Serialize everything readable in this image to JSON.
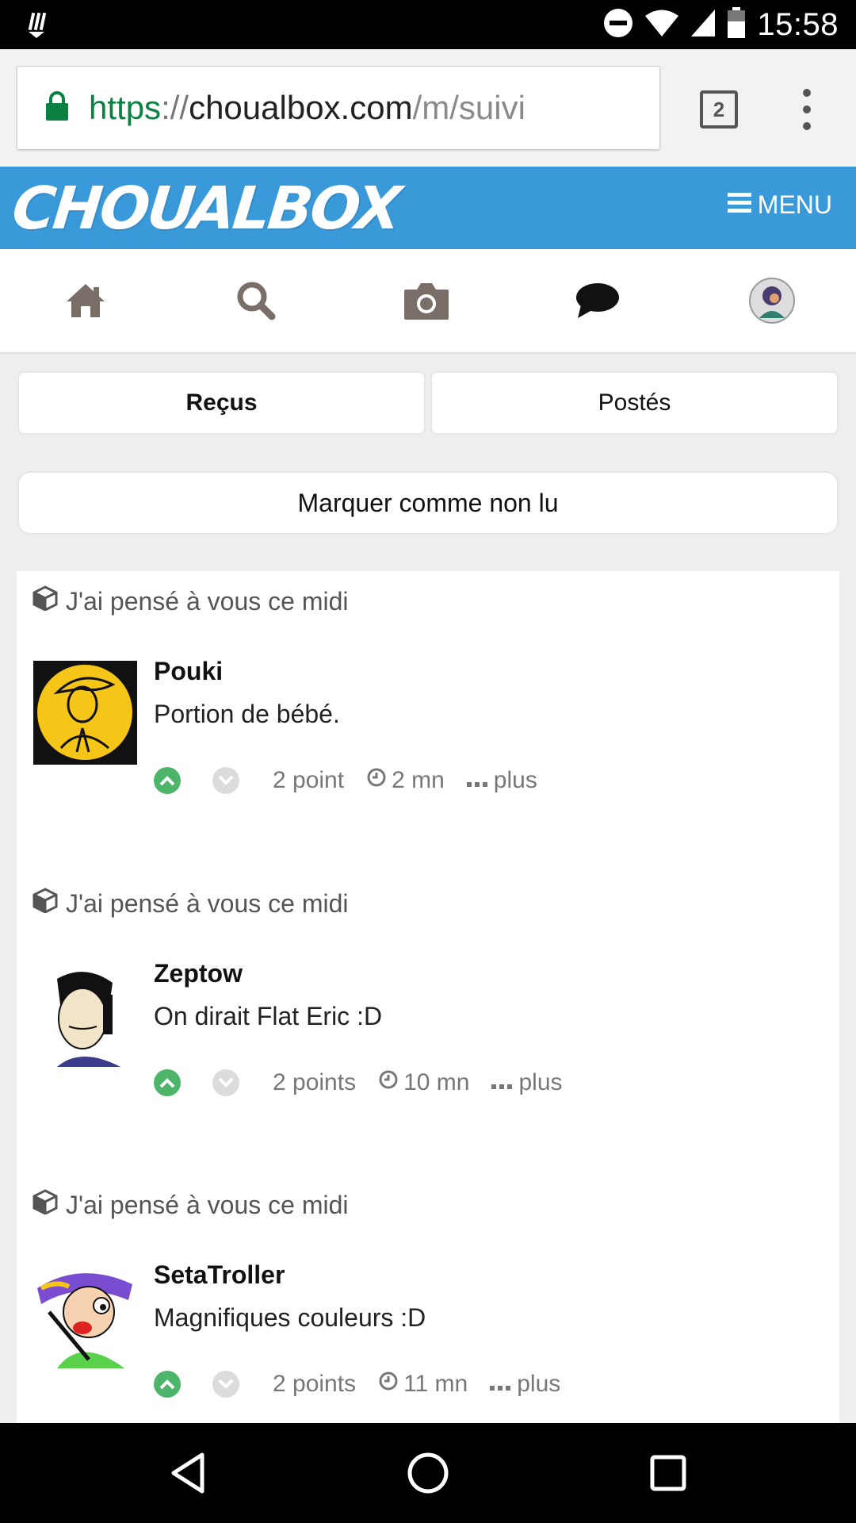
{
  "status_bar": {
    "time": "15:58"
  },
  "browser": {
    "url_scheme": "https",
    "url_sep": "://",
    "url_host": "choualbox.com",
    "url_path": "/m/suivi",
    "tab_count": "2"
  },
  "site": {
    "logo": "CHOUALBOX",
    "menu_label": "MENU",
    "brand_color": "#3a9ad9"
  },
  "nav_icons": [
    "home-icon",
    "search-icon",
    "camera-icon",
    "comment-icon",
    "avatar"
  ],
  "tabs": {
    "received": "Reçus",
    "posted": "Postés"
  },
  "mark_unread": "Marquer comme non lu",
  "comments": [
    {
      "post_title": "J'ai pensé à vous ce midi",
      "user": "Pouki",
      "text": "Portion de bébé.",
      "points": "2 point",
      "time": "2 mn",
      "more": "plus"
    },
    {
      "post_title": "J'ai pensé à vous ce midi",
      "user": "Zeptow",
      "text": "On dirait Flat Eric :D",
      "points": "2 points",
      "time": "10 mn",
      "more": "plus"
    },
    {
      "post_title": "J'ai pensé à vous ce midi",
      "user": "SetaTroller",
      "text": "Magnifiques couleurs :D",
      "points": "2 points",
      "time": "11 mn",
      "more": "plus"
    }
  ],
  "colors": {
    "upvote": "#4cb56a",
    "downvote": "#dcdcdc",
    "secure_green": "#0b8043"
  }
}
